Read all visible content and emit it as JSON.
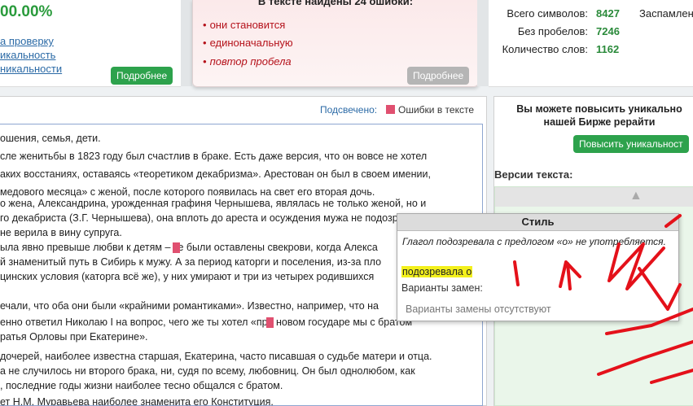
{
  "score": {
    "percent": "00.00%",
    "links": [
      "а проверку",
      "икальность",
      "никальности"
    ],
    "details_button": "Подробнее"
  },
  "errors_panel": {
    "title": "В тексте найдены 24 ошибки:",
    "items": [
      "они становится",
      "единоначальную",
      "повтор пробела"
    ],
    "details_button": "Подробнее"
  },
  "stats": {
    "rows": [
      {
        "label": "Всего символов:",
        "value": "8427"
      },
      {
        "label": "Без пробелов:",
        "value": "7246"
      },
      {
        "label": "Количество слов:",
        "value": "1162"
      }
    ],
    "extra": "Заспамлен"
  },
  "editor": {
    "highlight_label": "Подсвечено:",
    "highlight_legend": "Ошибки в тексте",
    "lines": [
      {
        "t": "ошения, семья, дети."
      },
      {
        "t": "сле женитьбы в 1823 году был счастлив в браке. Есть даже версия, что он вовсе не хотел"
      },
      {
        "t": "аких восстаниях, оставаясь «теоретиком декабризма». Арестован он был в своем имении,"
      },
      {
        "t": "медового месяца» с женой, после которого появилась на свет его вторая дочь."
      },
      {
        "t": "о жена, Александрина, урожденная графиня Чернышева, являлась не только женой, но и"
      },
      {
        "t": "го декабриста (З.Г. Чернышева), она вплоть до ареста и осуждения мужа не подозревала о"
      },
      {
        "t": "не верила в вину супруга."
      },
      {
        "t": "ыла явно превыше любви к детям – те были оставлены свекрови, когда Алекса"
      },
      {
        "t": "й знаменитый путь в Сибирь к мужу. А за период каторги и поселения, из-за пло"
      },
      {
        "t": "цинских условия (каторга всё же), у них умирают и три из четырех родившихся"
      },
      {
        "t": ""
      },
      {
        "t": "ечали, что оба они были «крайними романтиками». Известно, например, что на"
      },
      {
        "t": "енно ответил Николаю I на вопрос, чего же ты хотел «при новом государе мы с братом"
      },
      {
        "t": "ратья Орловы при Екатерине»."
      },
      {
        "t": ""
      },
      {
        "t": "дочерей, наиболее известна старшая, Екатерина, часто писавшая о судьбе матери и отца."
      },
      {
        "t": "а не случилось ни второго брака, ни, судя по всему, любовниц. Он был однолюбом, как"
      },
      {
        "t": ", последние годы жизни наиболее тесно общался с братом."
      },
      {
        "t": "ет Н.М. Муравьева наиболее знаменита его Конституция."
      }
    ]
  },
  "popup": {
    "title": "Стиль",
    "message": "Глагол подозревала с предлогом «о» не употребляется.",
    "phrase": "подозревала о",
    "replacements_label": "Варианты замен:",
    "none_text": "Варианты замены отсутствуют"
  },
  "right_panel": {
    "title_line1": "Вы можете повысить уникально",
    "title_line2": "нашей Бирже рерайти",
    "button": "Повысить уникальност",
    "versions_label": "Версии текста:"
  },
  "colors": {
    "accent_green": "#2da24c",
    "error_red": "#b5121b",
    "highlight_pink": "#e05070"
  }
}
